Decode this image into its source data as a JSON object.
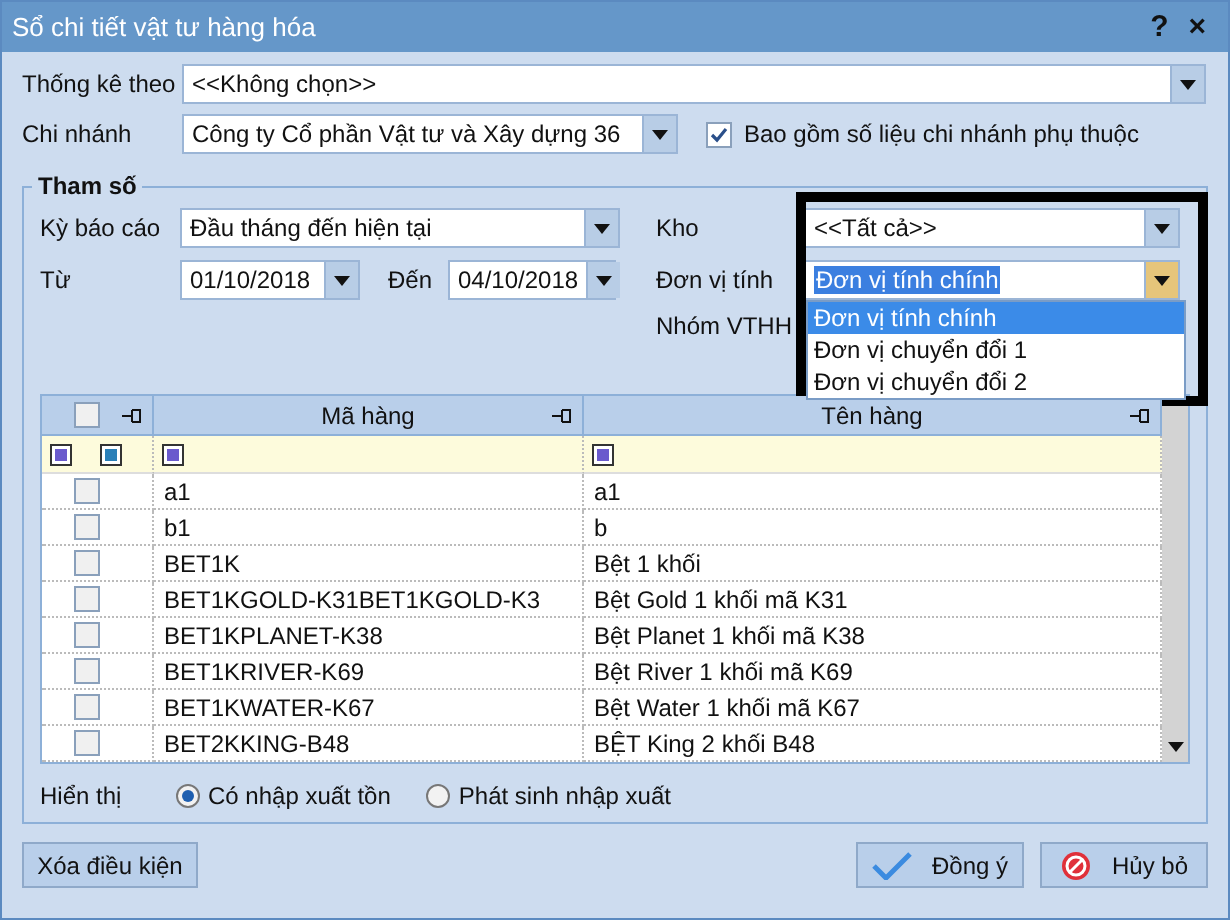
{
  "window": {
    "title": "Sổ chi tiết vật tư hàng hóa",
    "help_button": "?",
    "close_button": "×"
  },
  "stat_by": {
    "label": "Thống kê theo",
    "value": "<<Không chọn>>"
  },
  "branch": {
    "label": "Chi nhánh",
    "value": "Công ty Cổ phần Vật tư và Xây dựng 36"
  },
  "include_branches": {
    "label": "Bao gồm số liệu chi nhánh phụ thuộc",
    "checked": true
  },
  "params": {
    "title": "Tham số",
    "period": {
      "label": "Kỳ báo cáo",
      "value": "Đầu tháng đến hiện tại"
    },
    "from": {
      "label": "Từ",
      "value": "01/10/2018"
    },
    "to": {
      "label": "Đến",
      "value": "04/10/2018"
    },
    "warehouse": {
      "label": "Kho",
      "value": "<<Tất cả>>"
    },
    "unit": {
      "label": "Đơn vị tính",
      "value": "Đơn vị tính chính",
      "options": [
        {
          "label": "Đơn vị tính chính",
          "selected": true
        },
        {
          "label": "Đơn vị chuyển đổi 1",
          "selected": false
        },
        {
          "label": "Đơn vị chuyển đổi 2",
          "selected": false
        }
      ]
    },
    "item_group": {
      "label": "Nhóm VTHH"
    },
    "grid": {
      "header_checked": false,
      "columns": [
        "Mã hàng",
        "Tên hàng"
      ],
      "rows": [
        {
          "checked": false,
          "code": "a1",
          "name": "a1"
        },
        {
          "checked": false,
          "code": "b1",
          "name": "b"
        },
        {
          "checked": false,
          "code": "BET1K",
          "name": "Bệt 1 khối"
        },
        {
          "checked": false,
          "code": "BET1KGOLD-K31BET1KGOLD-K3",
          "name": "Bệt Gold 1 khối mã K31"
        },
        {
          "checked": false,
          "code": "BET1KPLANET-K38",
          "name": "Bệt Planet 1 khối mã K38"
        },
        {
          "checked": false,
          "code": "BET1KRIVER-K69",
          "name": "Bệt River 1 khối mã K69"
        },
        {
          "checked": false,
          "code": "BET1KWATER-K67",
          "name": "Bệt Water 1 khối mã K67"
        },
        {
          "checked": false,
          "code": "BET2KKING-B48",
          "name": "BỆT King 2 khối B48"
        }
      ]
    },
    "display": {
      "label": "Hiển thị",
      "options": [
        {
          "label": "Có nhập xuất tồn",
          "selected": true
        },
        {
          "label": "Phát sinh nhập xuất",
          "selected": false
        }
      ]
    }
  },
  "buttons": {
    "clear": "Xóa điều kiện",
    "ok": "Đồng ý",
    "cancel": "Hủy bỏ"
  }
}
